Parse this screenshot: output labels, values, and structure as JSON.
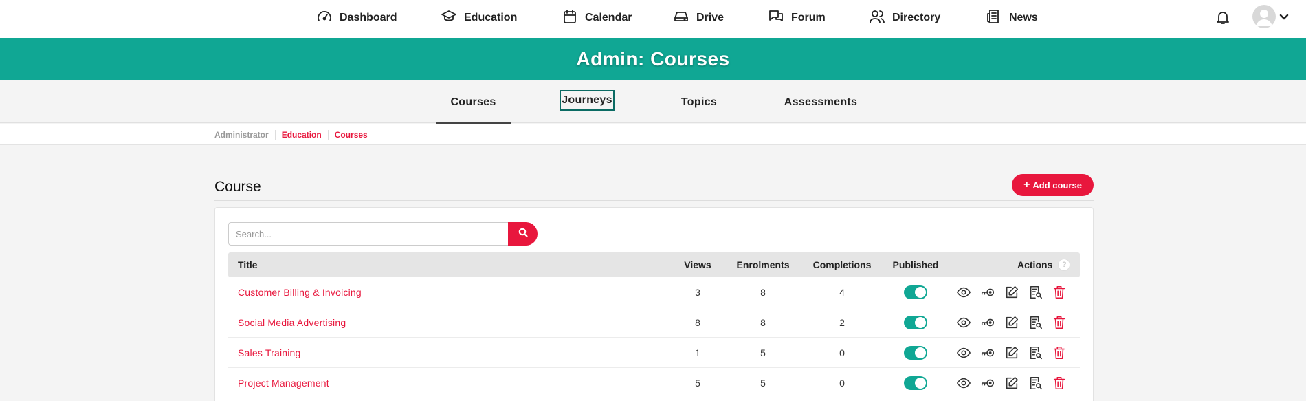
{
  "nav": {
    "items": [
      {
        "label": "Dashboard",
        "icon": "gauge-icon"
      },
      {
        "label": "Education",
        "icon": "graduation-cap-icon"
      },
      {
        "label": "Calendar",
        "icon": "calendar-icon"
      },
      {
        "label": "Drive",
        "icon": "hard-drive-icon"
      },
      {
        "label": "Forum",
        "icon": "chat-bubbles-icon"
      },
      {
        "label": "Directory",
        "icon": "users-icon"
      },
      {
        "label": "News",
        "icon": "newspaper-icon"
      }
    ]
  },
  "banner": {
    "title": "Admin: Courses"
  },
  "subnav": {
    "tabs": [
      {
        "label": "Courses",
        "state": "active"
      },
      {
        "label": "Journeys",
        "state": "focused"
      },
      {
        "label": "Topics",
        "state": "normal"
      },
      {
        "label": "Assessments",
        "state": "normal"
      }
    ]
  },
  "breadcrumb": [
    "Administrator",
    "Education",
    "Courses"
  ],
  "section": {
    "title": "Course",
    "add_button": "Add course"
  },
  "search": {
    "placeholder": "Search..."
  },
  "table": {
    "headers": {
      "title": "Title",
      "views": "Views",
      "enrolments": "Enrolments",
      "completions": "Completions",
      "published": "Published",
      "actions": "Actions",
      "help": "?"
    },
    "rows": [
      {
        "title": "Customer Billing & Invoicing",
        "views": "3",
        "enrolments": "8",
        "completions": "4",
        "published": true
      },
      {
        "title": "Social Media Advertising",
        "views": "8",
        "enrolments": "8",
        "completions": "2",
        "published": true
      },
      {
        "title": "Sales Training",
        "views": "1",
        "enrolments": "5",
        "completions": "0",
        "published": true
      },
      {
        "title": "Project Management",
        "views": "5",
        "enrolments": "5",
        "completions": "0",
        "published": true
      }
    ]
  },
  "colors": {
    "accent_teal": "#10a794",
    "accent_red": "#e8173d"
  }
}
